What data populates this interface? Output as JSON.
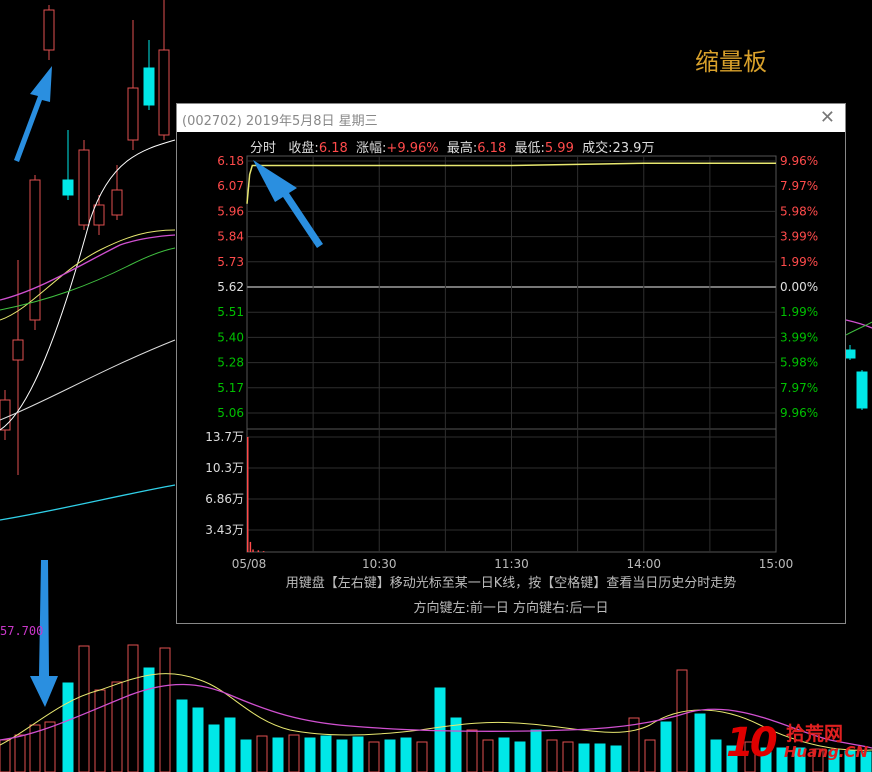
{
  "background_label": "缩量板",
  "side_value": "57.700",
  "watermark": {
    "number": "10",
    "chinese": "拾荒网",
    "english": "Huang.CN"
  },
  "popup": {
    "title": "(002702) 2019年5月8日 星期三",
    "close_icon": "close-icon",
    "info": {
      "mode": "分时",
      "close_label": "收盘:",
      "close_value": "6.18",
      "change_label": "涨幅:",
      "change_value": "+9.96%",
      "high_label": "最高:",
      "high_value": "6.18",
      "low_label": "最低:",
      "low_value": "5.99",
      "volume_label": "成交:",
      "volume_value": "23.9万"
    },
    "help_line1": "用键盘【左右键】移动光标至某一日K线，按【空格键】查看当日历史分时走势",
    "help_line2": "方向键左:前一日   方向键右:后一日"
  },
  "chart_data": {
    "type": "line",
    "price_axis": {
      "left_labels": [
        "6.18",
        "6.07",
        "5.96",
        "5.84",
        "5.73",
        "5.62",
        "5.51",
        "5.40",
        "5.28",
        "5.17",
        "5.06"
      ],
      "right_labels": [
        "9.96%",
        "7.97%",
        "5.98%",
        "3.99%",
        "1.99%",
        "0.00%",
        "1.99%",
        "3.99%",
        "5.98%",
        "7.97%",
        "9.96%"
      ],
      "ylim": [
        5.06,
        6.18
      ],
      "reference_close": 5.62
    },
    "volume_axis": {
      "labels": [
        "13.7万",
        "10.3万",
        "6.86万",
        "3.43万"
      ],
      "ylim": [
        0,
        13.7
      ]
    },
    "time_axis": {
      "labels": [
        "05/08",
        "10:30",
        "11:30",
        "14:00",
        "15:00"
      ]
    },
    "price_series": {
      "x": [
        0,
        0.005,
        0.01,
        0.25,
        0.5,
        0.75,
        1.0
      ],
      "values": [
        5.99,
        6.12,
        6.16,
        6.16,
        6.16,
        6.17,
        6.17
      ]
    },
    "volume_series": {
      "x": [
        0,
        0.005,
        0.01,
        0.02,
        0.03
      ],
      "values": [
        13.7,
        1.2,
        0.3,
        0.2,
        0.1
      ]
    },
    "colors": {
      "up": "#ff4b4b",
      "down": "#00c000",
      "neutral": "#e0e0e0",
      "price_line": "#e8e870",
      "cyan": "#00f0f0"
    }
  }
}
